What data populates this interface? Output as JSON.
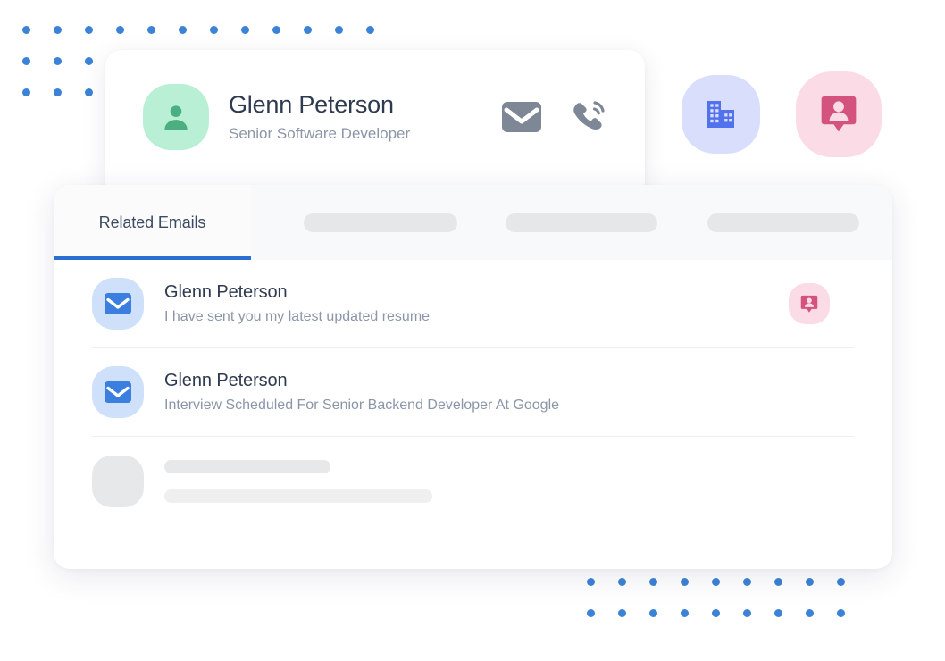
{
  "contact": {
    "name": "Glenn Peterson",
    "title": "Senior Software Developer",
    "avatar_icon": "person-icon",
    "actions": [
      {
        "icon": "envelope-icon",
        "label": "Email"
      },
      {
        "icon": "phone-ring-icon",
        "label": "Call"
      }
    ]
  },
  "floating_badges": [
    {
      "icon": "office-building-icon",
      "label": "Company",
      "bg": "#d8defb",
      "fg": "#5271ec"
    },
    {
      "icon": "contact-card-icon",
      "label": "Contact",
      "bg": "#fbdce6",
      "fg": "#d4537e"
    }
  ],
  "tabs": {
    "active_index": 0,
    "items": [
      {
        "label": "Related Emails",
        "placeholder": false
      },
      {
        "label": "",
        "placeholder": true
      },
      {
        "label": "",
        "placeholder": true
      },
      {
        "label": "",
        "placeholder": true
      }
    ]
  },
  "emails": [
    {
      "sender": "Glenn Peterson",
      "subject": "I have sent you my latest updated resume",
      "icon": "envelope-icon",
      "badge": "contact-card-icon",
      "has_badge": true
    },
    {
      "sender": "Glenn Peterson",
      "subject": "Interview Scheduled For Senior Backend Developer At Google",
      "icon": "envelope-icon",
      "badge": "",
      "has_badge": false
    },
    {
      "sender": "",
      "subject": "",
      "icon": "",
      "badge": "",
      "has_badge": false,
      "placeholder": true
    }
  ],
  "decor": {
    "dot_color": "#3c82d6",
    "top_left_grid": {
      "rows": 3,
      "cols_row1": 12,
      "cols_other": 3,
      "spacing": 35
    },
    "bottom_right_grid": {
      "rows": 2,
      "cols": 9,
      "spacing": 35
    }
  },
  "colors": {
    "accent_blue": "#2b6fd1",
    "avatar_green_bg": "#b9f0d5",
    "avatar_green_fg": "#4caf82",
    "email_icon_bg": "#cfe0fb",
    "email_icon_fg": "#3c7de0",
    "text_primary": "#2e3a50",
    "text_secondary": "#8b96a8",
    "skeleton_gray": "#e7e8e9",
    "page_bg": "#ffffff"
  }
}
